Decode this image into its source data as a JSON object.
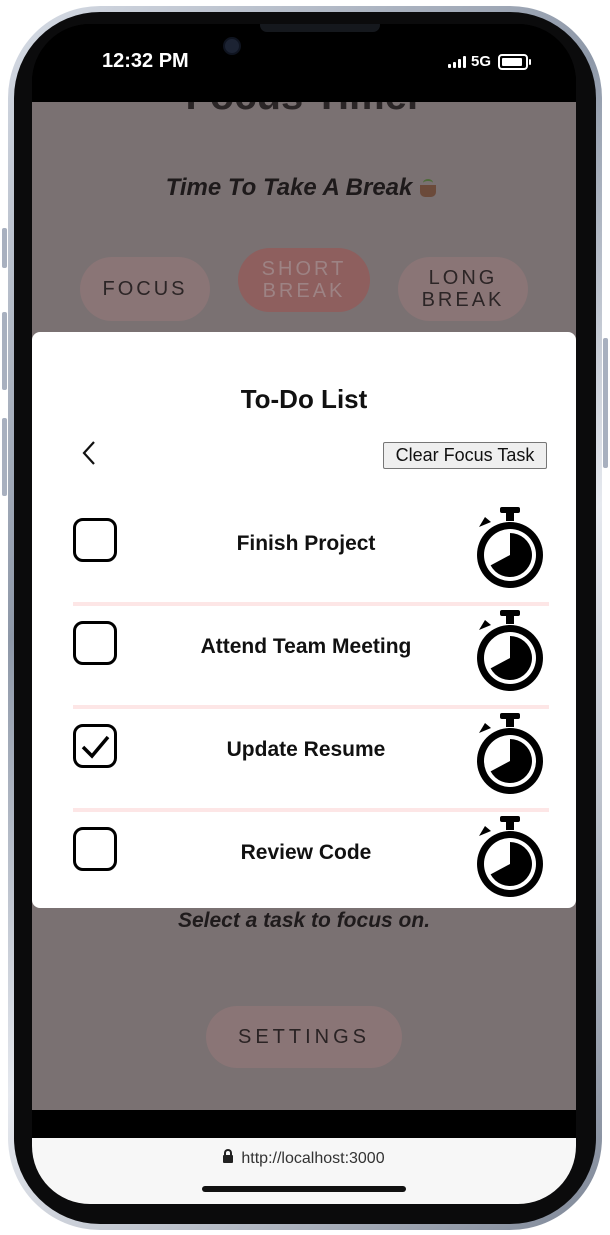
{
  "status_bar": {
    "time": "12:32 PM",
    "network": "5G"
  },
  "app": {
    "title": "Focus Timer",
    "subtitle": "Time To Take A Break",
    "subtitle_emoji": "coffee-icon",
    "modes": [
      {
        "label": "FOCUS",
        "active": false
      },
      {
        "label": "SHORT BREAK",
        "active": true
      },
      {
        "label": "LONG BREAK",
        "active": false
      }
    ],
    "hint": "Select a task to focus on.",
    "settings_label": "SETTINGS"
  },
  "modal": {
    "title": "To-Do List",
    "back_icon": "chevron-left-icon",
    "clear_label": "Clear Focus Task",
    "tasks": [
      {
        "label": "Finish Project",
        "checked": false
      },
      {
        "label": "Attend Team Meeting",
        "checked": false
      },
      {
        "label": "Update Resume",
        "checked": true
      },
      {
        "label": "Review Code",
        "checked": false
      }
    ]
  },
  "browser": {
    "url": "http://localhost:3000"
  },
  "colors": {
    "overlay": "#7a7172",
    "accent_active": "#8e5f5e",
    "divider": "#fde6e6"
  }
}
